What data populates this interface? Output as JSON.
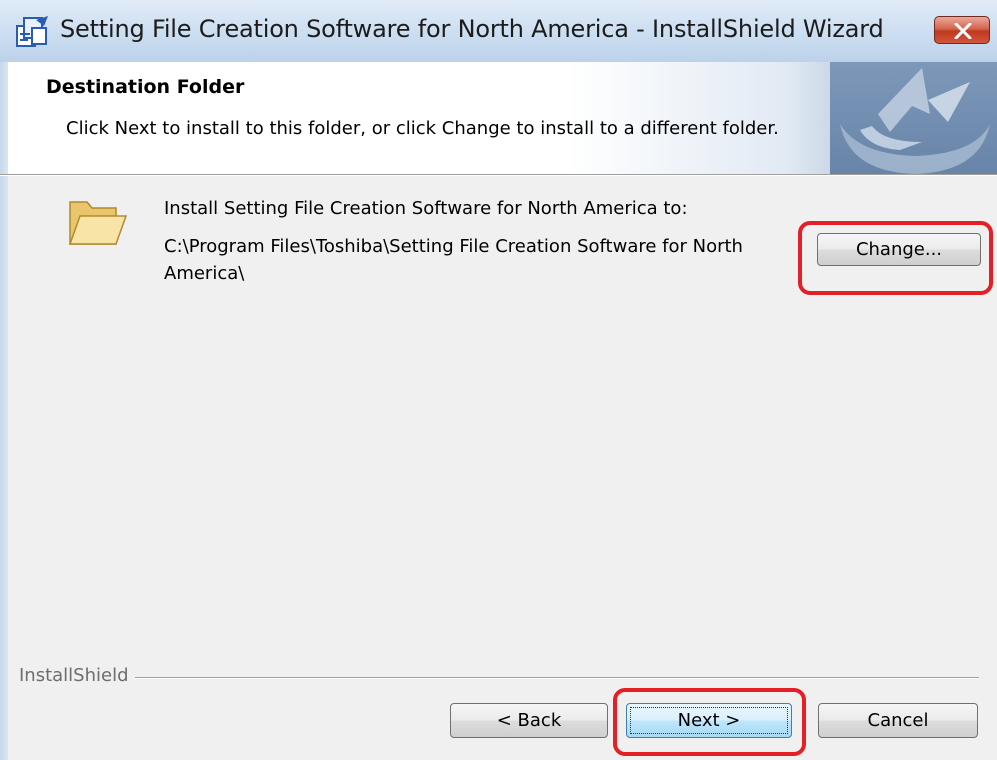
{
  "window": {
    "title": "Setting File Creation Software for North America - InstallShield Wizard",
    "close_icon": "close-icon"
  },
  "header": {
    "title": "Destination Folder",
    "description": "Click Next to install to this folder, or click Change to install to a different folder."
  },
  "body": {
    "folder_icon": "folder-icon",
    "install_label": "Install Setting File Creation Software for North America to:",
    "install_path": "C:\\Program Files\\Toshiba\\Setting File Creation Software for North America\\",
    "change_button": "Change..."
  },
  "footer": {
    "brand": "InstallShield",
    "back_button": "< Back",
    "next_button": "Next >",
    "cancel_button": "Cancel"
  },
  "colors": {
    "highlight": "#e32026",
    "close_button": "#c0391f",
    "header_banner": "#6884a8"
  }
}
